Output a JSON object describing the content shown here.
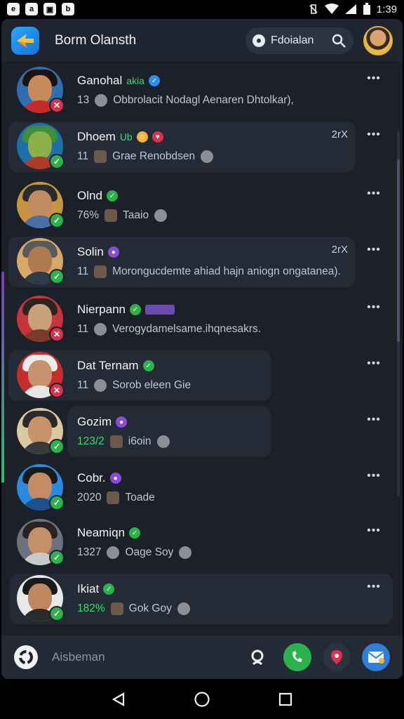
{
  "status_bar": {
    "time": "1:39"
  },
  "header": {
    "app_title": "Borm Olansth",
    "search_label": "Fdoialan"
  },
  "chats": [
    {
      "name": "Ganohal",
      "name_extra": "akia",
      "tag": "blue",
      "count": "13",
      "preview": "Obbrolacit   Nodagl Aenaren Dhtolkar),",
      "time": "",
      "badge": "alert",
      "badge_icon": "✕",
      "bg": false
    },
    {
      "name": "Dhoem",
      "name_extra": "Ub",
      "tag": "emoji",
      "count": "11",
      "preview": "Grae Renobdsen",
      "time": "2rX",
      "badge": "ok",
      "badge_icon": "✓",
      "bg": true
    },
    {
      "name": "Olnd",
      "name_extra": "",
      "tag": "green",
      "count": "76%",
      "preview": "Taaio",
      "time": "",
      "badge": "ok",
      "badge_icon": "✓",
      "bg": false
    },
    {
      "name": "Solin",
      "name_extra": "",
      "tag": "purple",
      "count": "11",
      "preview": "Morongucdemte ahiad hajn aniogn ongatanea).",
      "time": "2rX",
      "badge": "ok",
      "badge_icon": "✓",
      "bg": true
    },
    {
      "name": "Nierpann",
      "name_extra": "",
      "tag": "green-pill",
      "count": "11",
      "preview": "Verogydamelsame.ihqnesakrs.",
      "time": "",
      "badge": "alert",
      "badge_icon": "✕",
      "bg": false
    },
    {
      "name": "Dat Ternam",
      "name_extra": "",
      "tag": "green",
      "count": "11",
      "preview": "Sorob eleen Gie",
      "time": "",
      "badge": "alert",
      "badge_icon": "✕",
      "bg": true
    },
    {
      "name": "Gozim",
      "name_extra": "",
      "tag": "purple",
      "count": "123/2",
      "preview": "i6oin",
      "time": "",
      "badge": "ok",
      "badge_icon": "✓",
      "bg": true
    },
    {
      "name": "Cobr.",
      "name_extra": "",
      "tag": "purple",
      "count": "2020",
      "preview": "Toade",
      "time": "",
      "badge": "ok",
      "badge_icon": "✓",
      "bg": false
    },
    {
      "name": "Neamiqn",
      "name_extra": "",
      "tag": "green",
      "count": "1327",
      "preview": "Oage Soy",
      "time": "",
      "badge": "ok",
      "badge_icon": "✓",
      "bg": false
    },
    {
      "name": "Ikiat",
      "name_extra": "",
      "tag": "green",
      "count": "182%",
      "preview": "Gok Goy",
      "time": "",
      "badge": "ok",
      "badge_icon": "✓",
      "bg": true
    }
  ],
  "bottom_bar": {
    "placeholder": "Aisbeman"
  },
  "colors": {
    "accent": "#2aa6ff",
    "online": "#2bb24c",
    "alert": "#d8324c",
    "panel": "#1b2029"
  }
}
